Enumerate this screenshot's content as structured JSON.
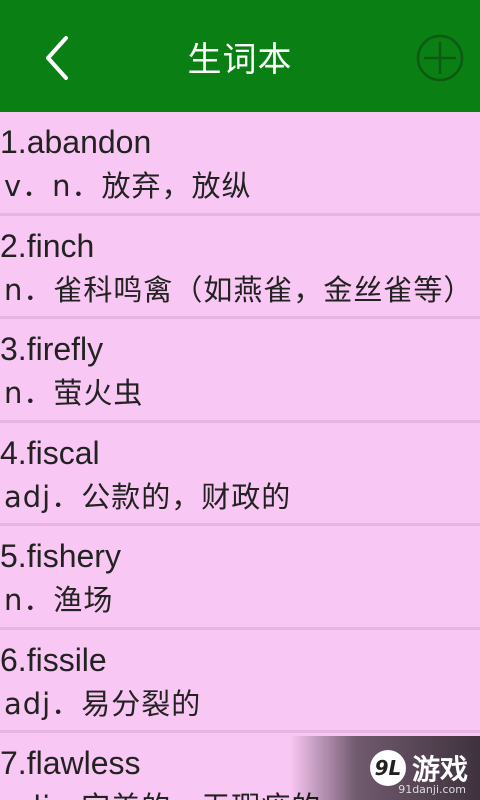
{
  "header": {
    "title": "生词本",
    "back_icon": "chevron-left-icon",
    "add_icon": "plus-circle-icon",
    "bar_color": "#0a7f14"
  },
  "words": [
    {
      "index": "1.abandon",
      "definition": "v．n．放弃，放纵"
    },
    {
      "index": "2.finch",
      "definition": "n．雀科鸣禽（如燕雀，金丝雀等）"
    },
    {
      "index": "3.firefly",
      "definition": "n．萤火虫"
    },
    {
      "index": "4.fiscal",
      "definition": "adj．公款的，财政的"
    },
    {
      "index": "5.fishery",
      "definition": "n．渔场"
    },
    {
      "index": "6.fissile",
      "definition": "adj．易分裂的"
    },
    {
      "index": "7.flawless",
      "definition": "adj．完美的，无瑕疵的"
    }
  ],
  "watermark": {
    "logo_text": "9L",
    "brand": "游戏",
    "url": "91danji.com"
  },
  "colors": {
    "background": "#f9c7f4",
    "divider": "#e8b5e3"
  }
}
